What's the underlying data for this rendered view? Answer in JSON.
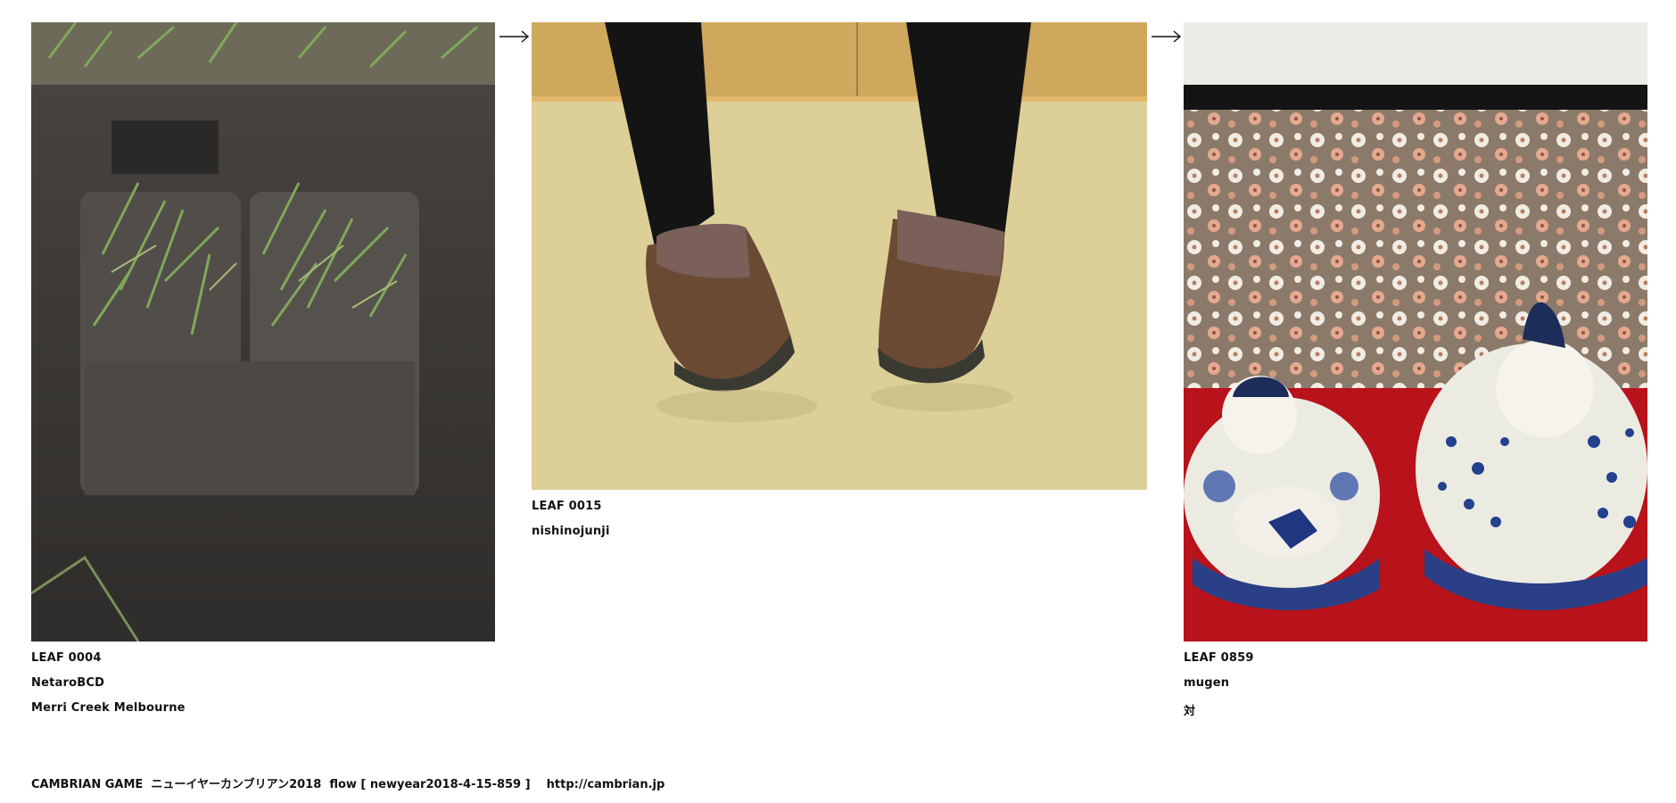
{
  "leaves": [
    {
      "id": "LEAF 0004",
      "author": "NetaroBCD",
      "title": "Merri Creek Melbourne",
      "image": "grass-turf-photo"
    },
    {
      "id": "LEAF 0015",
      "author": "nishinojunji",
      "title": "",
      "image": "brown-boots-photo"
    },
    {
      "id": "LEAF 0859",
      "author": "mugen",
      "title": "対",
      "image": "porcelain-dolls-photo"
    }
  ],
  "arrows": [
    "arrow-right-icon",
    "arrow-right-icon"
  ],
  "footer": {
    "brand": "CAMBRIAN GAME",
    "event": "ニューイヤーカンブリアン2018",
    "flow": "flow [ newyear2018-4-15-859 ]",
    "link": "http://cambrian.jp"
  },
  "colors": {
    "background": "#ffffff",
    "text": "#111111"
  }
}
